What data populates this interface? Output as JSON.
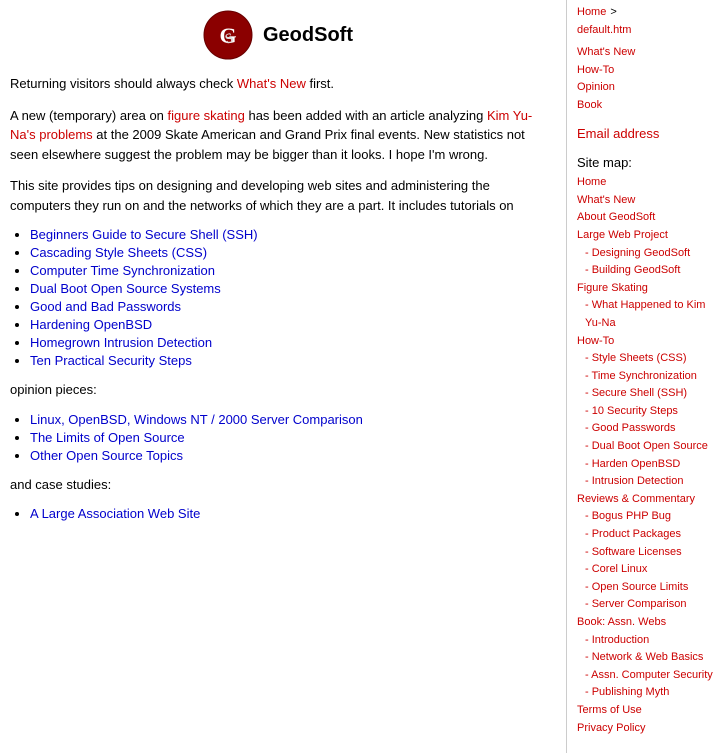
{
  "header": {
    "title": "GeodSoft",
    "logo_alt": "GeodSoft Logo"
  },
  "breadcrumb": {
    "home": "Home",
    "separator": ">",
    "current": "default.htm"
  },
  "intro": {
    "line1": "Returning visitors should always check ",
    "whats_new_link": "What's New",
    "line1_end": " first.",
    "para2_start": "A new (temporary) area on ",
    "figure_skating_link": "figure skating",
    "para2_mid": " has been added with an article analyzing ",
    "kim_link": "Kim Yu-Na's problems",
    "para2_end": " at the 2009 Skate American and Grand Prix final events. New statistics not seen elsewhere suggest the problem may be bigger than it looks. I hope I'm wrong.",
    "para3": "This site provides tips on designing and developing web sites and administering the computers they run on and the networks of which they are a part. It includes tutorials on"
  },
  "tutorials": [
    {
      "text": "Beginners Guide to Secure Shell (SSH)"
    },
    {
      "text": "Cascading Style Sheets (CSS)"
    },
    {
      "text": "Computer Time Synchronization"
    },
    {
      "text": "Dual Boot Open Source Systems"
    },
    {
      "text": "Good and Bad Passwords"
    },
    {
      "text": "Hardening OpenBSD"
    },
    {
      "text": "Homegrown Intrusion Detection"
    },
    {
      "text": "Ten Practical Security Steps"
    }
  ],
  "opinion_label": "opinion pieces:",
  "opinions": [
    {
      "text": "Linux, OpenBSD, Windows NT / 2000 Server Comparison"
    },
    {
      "text": "The Limits of Open Source"
    },
    {
      "text": "Other Open Source Topics"
    }
  ],
  "case_studies_label": "and case studies:",
  "case_studies": [
    {
      "text": "A Large Association Web Site"
    }
  ],
  "sidebar": {
    "nav_links": [
      {
        "text": "What's New"
      },
      {
        "text": "How-To"
      },
      {
        "text": "Opinion"
      },
      {
        "text": "Book"
      }
    ],
    "email_heading": "Email address",
    "sitemap_heading": "Site map:",
    "sitemap_items": [
      {
        "text": "Home",
        "indent": 0
      },
      {
        "text": "What's New",
        "indent": 0
      },
      {
        "text": "About GeodSoft",
        "indent": 0
      },
      {
        "text": "Large Web Project",
        "indent": 0
      },
      {
        "text": "- Designing GeodSoft",
        "indent": 1
      },
      {
        "text": "- Building GeodSoft",
        "indent": 1
      },
      {
        "text": "Figure Skating",
        "indent": 0
      },
      {
        "text": "- What Happened to Kim Yu-Na",
        "indent": 1
      },
      {
        "text": "How-To",
        "indent": 0
      },
      {
        "text": "- Style Sheets (CSS)",
        "indent": 1
      },
      {
        "text": "- Time Synchronization",
        "indent": 1
      },
      {
        "text": "- Secure Shell (SSH)",
        "indent": 1
      },
      {
        "text": "- 10 Security Steps",
        "indent": 1
      },
      {
        "text": "- Good Passwords",
        "indent": 1
      },
      {
        "text": "- Dual Boot Open Source",
        "indent": 1
      },
      {
        "text": "- Harden OpenBSD",
        "indent": 1
      },
      {
        "text": "- Intrusion Detection",
        "indent": 1
      },
      {
        "text": "Reviews & Commentary",
        "indent": 0
      },
      {
        "text": "- Bogus PHP Bug",
        "indent": 1
      },
      {
        "text": "- Product Packages",
        "indent": 1
      },
      {
        "text": "- Software Licenses",
        "indent": 1
      },
      {
        "text": "- Corel Linux",
        "indent": 1
      },
      {
        "text": "- Open Source Limits",
        "indent": 1
      },
      {
        "text": "- Server Comparison",
        "indent": 1
      },
      {
        "text": "Book: Assn. Webs",
        "indent": 0
      },
      {
        "text": "- Introduction",
        "indent": 1
      },
      {
        "text": "- Network & Web Basics",
        "indent": 1
      },
      {
        "text": "- Assn. Computer Security",
        "indent": 1
      },
      {
        "text": "- Publishing Myth",
        "indent": 1
      },
      {
        "text": "Terms of Use",
        "indent": 0
      },
      {
        "text": "Privacy Policy",
        "indent": 0
      }
    ]
  }
}
